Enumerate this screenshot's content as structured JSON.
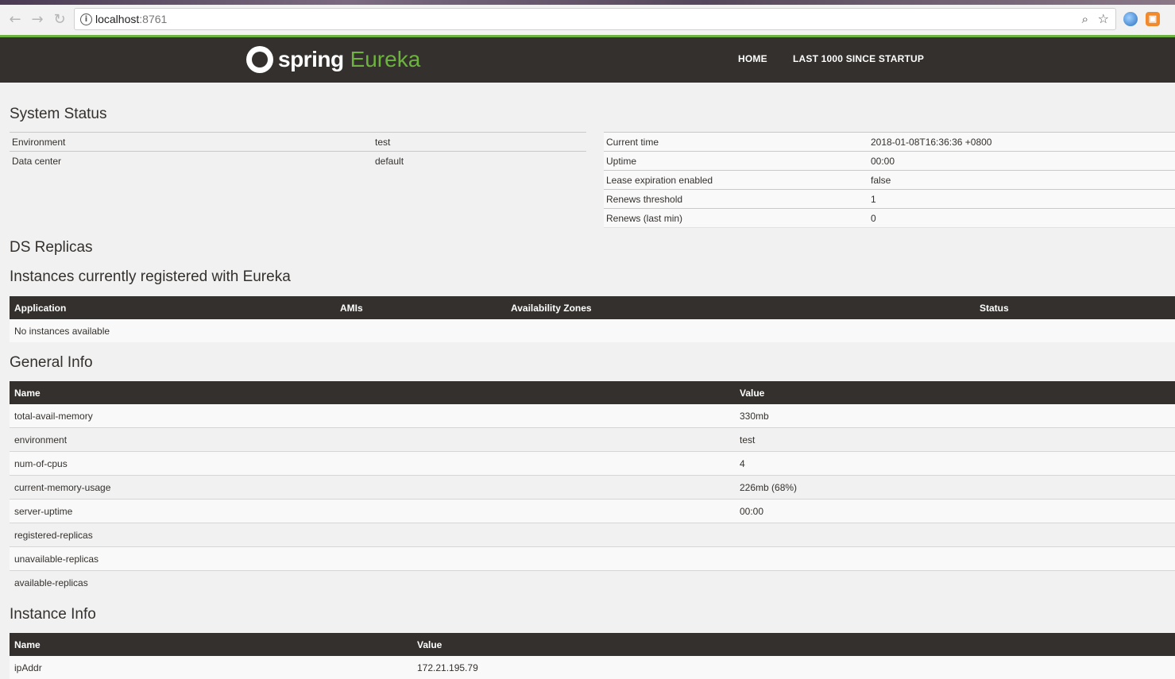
{
  "browser": {
    "url_host": "localhost",
    "url_port": ":8761"
  },
  "header": {
    "brand_spring": "spring",
    "brand_eureka": "Eureka",
    "nav": [
      "HOME",
      "LAST 1000 SINCE STARTUP"
    ]
  },
  "system_status": {
    "title": "System Status",
    "left": [
      {
        "label": "Environment",
        "value": "test"
      },
      {
        "label": "Data center",
        "value": "default"
      }
    ],
    "right": [
      {
        "label": "Current time",
        "value": "2018-01-08T16:36:36 +0800"
      },
      {
        "label": "Uptime",
        "value": "00:00"
      },
      {
        "label": "Lease expiration enabled",
        "value": "false"
      },
      {
        "label": "Renews threshold",
        "value": "1"
      },
      {
        "label": "Renews (last min)",
        "value": "0"
      }
    ]
  },
  "ds_replicas": {
    "title": "DS Replicas"
  },
  "instances": {
    "title": "Instances currently registered with Eureka",
    "columns": [
      "Application",
      "AMIs",
      "Availability Zones",
      "Status"
    ],
    "empty_text": "No instances available"
  },
  "general_info": {
    "title": "General Info",
    "columns": [
      "Name",
      "Value"
    ],
    "rows": [
      {
        "name": "total-avail-memory",
        "value": "330mb"
      },
      {
        "name": "environment",
        "value": "test"
      },
      {
        "name": "num-of-cpus",
        "value": "4"
      },
      {
        "name": "current-memory-usage",
        "value": "226mb (68%)"
      },
      {
        "name": "server-uptime",
        "value": "00:00"
      },
      {
        "name": "registered-replicas",
        "value": ""
      },
      {
        "name": "unavailable-replicas",
        "value": ""
      },
      {
        "name": "available-replicas",
        "value": ""
      }
    ]
  },
  "instance_info": {
    "title": "Instance Info",
    "columns": [
      "Name",
      "Value"
    ],
    "rows": [
      {
        "name": "ipAddr",
        "value": "172.21.195.79"
      }
    ]
  },
  "colors": {
    "navbar": "#34302d",
    "accent_green": "#6db33f",
    "background": "#f1f1f1"
  }
}
